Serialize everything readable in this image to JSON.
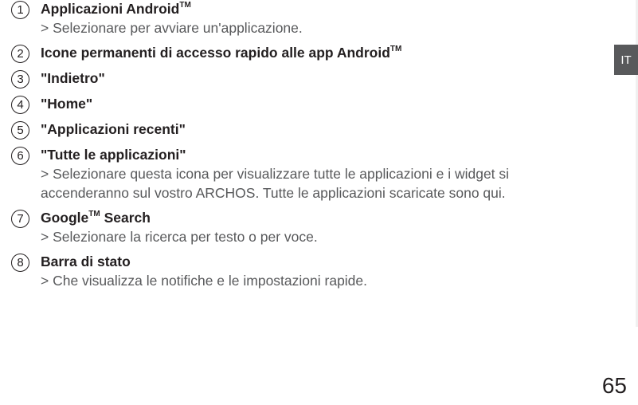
{
  "lang_tab": "IT",
  "page_number": "65",
  "items": [
    {
      "num": "1",
      "title_pre": "Applicazioni Android",
      "title_tm": "TM",
      "title_post": "",
      "desc": " > Selezionare per avviare un'applicazione."
    },
    {
      "num": "2",
      "title_pre": "Icone permanenti di accesso rapido alle app Android",
      "title_tm": "TM",
      "title_post": "",
      "desc": ""
    },
    {
      "num": "3",
      "title_pre": "\"Indietro\"",
      "title_tm": "",
      "title_post": "",
      "desc": ""
    },
    {
      "num": "4",
      "title_pre": "\"Home\"",
      "title_tm": "",
      "title_post": "",
      "desc": ""
    },
    {
      "num": "5",
      "title_pre": "\"Applicazioni recenti\"",
      "title_tm": "",
      "title_post": "",
      "desc": ""
    },
    {
      "num": "6",
      "title_pre": "\"Tutte le applicazioni\"",
      "title_tm": "",
      "title_post": "",
      "desc": " > Selezionare questa icona per visualizzare tutte le applicazioni e i widget si accenderanno sul vostro ARCHOS. Tutte le applicazioni scaricate sono qui."
    },
    {
      "num": "7",
      "title_pre": "Google",
      "title_tm": "TM",
      "title_post": " Search",
      "desc": " > Selezionare la ricerca per testo o per voce."
    },
    {
      "num": "8",
      "title_pre": "Barra di stato",
      "title_tm": "",
      "title_post": "",
      "desc": " > Che visualizza le notifiche e le impostazioni rapide."
    }
  ]
}
